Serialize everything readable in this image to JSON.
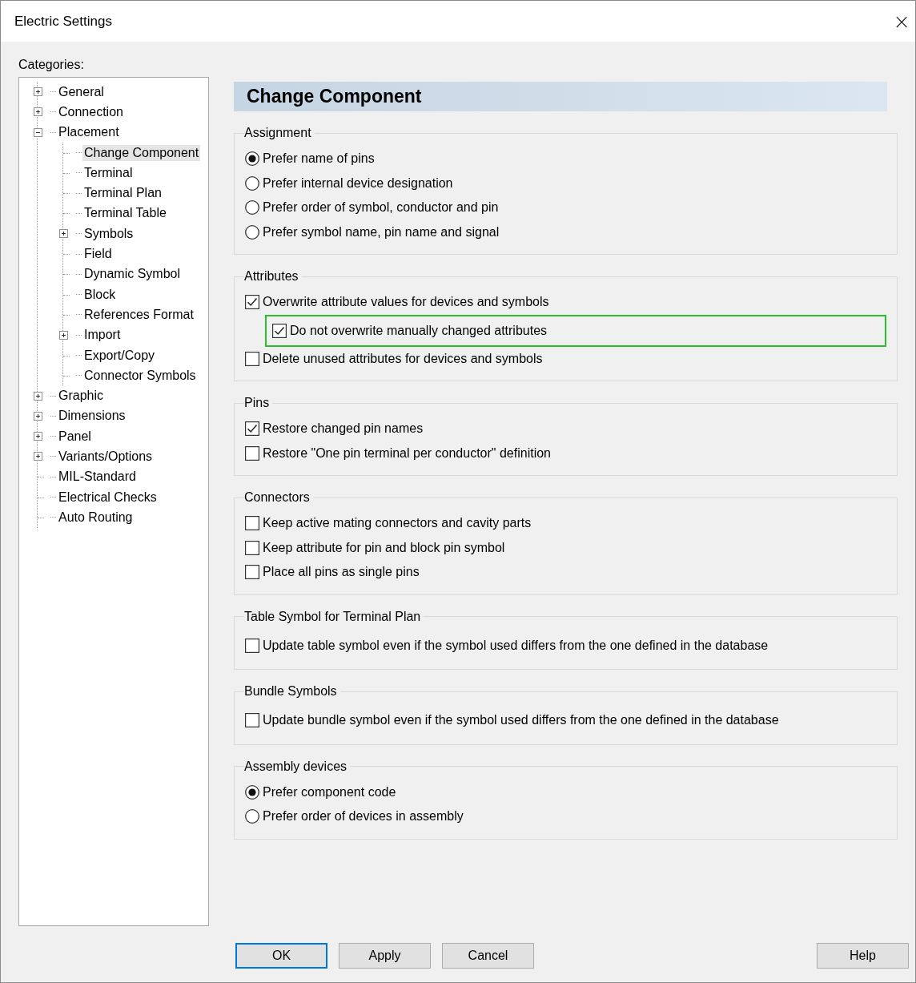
{
  "window": {
    "title": "Electric Settings",
    "close": "×"
  },
  "categories": {
    "label": "Categories:",
    "items": [
      {
        "label": "General",
        "expanded": false,
        "selected": false
      },
      {
        "label": "Connection",
        "expanded": false,
        "selected": false
      },
      {
        "label": "Placement",
        "expanded": true,
        "selected": false,
        "children": [
          {
            "label": "Change Component",
            "selected": true
          },
          {
            "label": "Terminal",
            "selected": false
          },
          {
            "label": "Terminal Plan",
            "selected": false
          },
          {
            "label": "Terminal Table",
            "selected": false
          },
          {
            "label": "Symbols",
            "expanded": false,
            "selected": false
          },
          {
            "label": "Field",
            "selected": false
          },
          {
            "label": "Dynamic Symbol",
            "selected": false
          },
          {
            "label": "Block",
            "selected": false
          },
          {
            "label": "References Format",
            "selected": false
          },
          {
            "label": "Import",
            "expanded": false,
            "selected": false
          },
          {
            "label": "Export/Copy",
            "selected": false
          },
          {
            "label": "Connector Symbols",
            "selected": false
          }
        ]
      },
      {
        "label": "Graphic",
        "expanded": false,
        "selected": false
      },
      {
        "label": "Dimensions",
        "expanded": false,
        "selected": false
      },
      {
        "label": "Panel",
        "expanded": false,
        "selected": false
      },
      {
        "label": "Variants/Options",
        "expanded": false,
        "selected": false
      },
      {
        "label": "MIL-Standard",
        "selected": false
      },
      {
        "label": "Electrical Checks",
        "selected": false
      },
      {
        "label": "Auto Routing",
        "selected": false
      }
    ]
  },
  "page": {
    "title": "Change Component",
    "groups": [
      {
        "title": "Assignment",
        "options": [
          {
            "kind": "radio",
            "label": "Prefer name of pins",
            "selected": true
          },
          {
            "kind": "radio",
            "label": "Prefer internal device designation",
            "selected": false
          },
          {
            "kind": "radio",
            "label": "Prefer order of symbol, conductor and pin",
            "selected": false
          },
          {
            "kind": "radio",
            "label": "Prefer symbol name, pin name and signal",
            "selected": false
          }
        ]
      },
      {
        "title": "Attributes",
        "options": [
          {
            "kind": "checkbox",
            "label": "Overwrite attribute values for devices and symbols",
            "checked": true,
            "indented": false,
            "highlighted": false
          },
          {
            "kind": "checkbox",
            "label": "Do not overwrite manually changed attributes",
            "checked": true,
            "indented": true,
            "highlighted": true
          },
          {
            "kind": "checkbox",
            "label": "Delete unused attributes for devices and symbols",
            "checked": false,
            "indented": false,
            "highlighted": false
          }
        ]
      },
      {
        "title": "Pins",
        "options": [
          {
            "kind": "checkbox",
            "label": "Restore changed pin names",
            "checked": true,
            "indented": false,
            "highlighted": false
          },
          {
            "kind": "checkbox",
            "label": "Restore \"One pin terminal per conductor\" definition",
            "checked": false,
            "indented": false,
            "highlighted": false
          }
        ]
      },
      {
        "title": "Connectors",
        "options": [
          {
            "kind": "checkbox",
            "label": "Keep active mating connectors and cavity parts",
            "checked": false,
            "indented": false,
            "highlighted": false
          },
          {
            "kind": "checkbox",
            "label": "Keep attribute for pin and block pin symbol",
            "checked": false,
            "indented": false,
            "highlighted": false
          },
          {
            "kind": "checkbox",
            "label": "Place all pins as single pins",
            "checked": false,
            "indented": false,
            "highlighted": false
          }
        ]
      },
      {
        "title": "Table Symbol for Terminal Plan",
        "options": [
          {
            "kind": "checkbox",
            "label": "Update table symbol even if the symbol used differs from the one defined in the database",
            "checked": false,
            "indented": false,
            "highlighted": false
          }
        ]
      },
      {
        "title": "Bundle Symbols",
        "options": [
          {
            "kind": "checkbox",
            "label": "Update bundle symbol even if the symbol used differs from the one defined in the database",
            "checked": false,
            "indented": false,
            "highlighted": false
          }
        ]
      },
      {
        "title": "Assembly devices",
        "options": [
          {
            "kind": "radio",
            "label": "Prefer component code",
            "selected": true
          },
          {
            "kind": "radio",
            "label": "Prefer order of devices in assembly",
            "selected": false
          }
        ]
      }
    ]
  },
  "buttons": [
    {
      "label": "OK",
      "default": true
    },
    {
      "label": "Apply",
      "default": false
    },
    {
      "label": "Cancel",
      "default": false
    },
    {
      "label": "Help",
      "default": false
    }
  ]
}
